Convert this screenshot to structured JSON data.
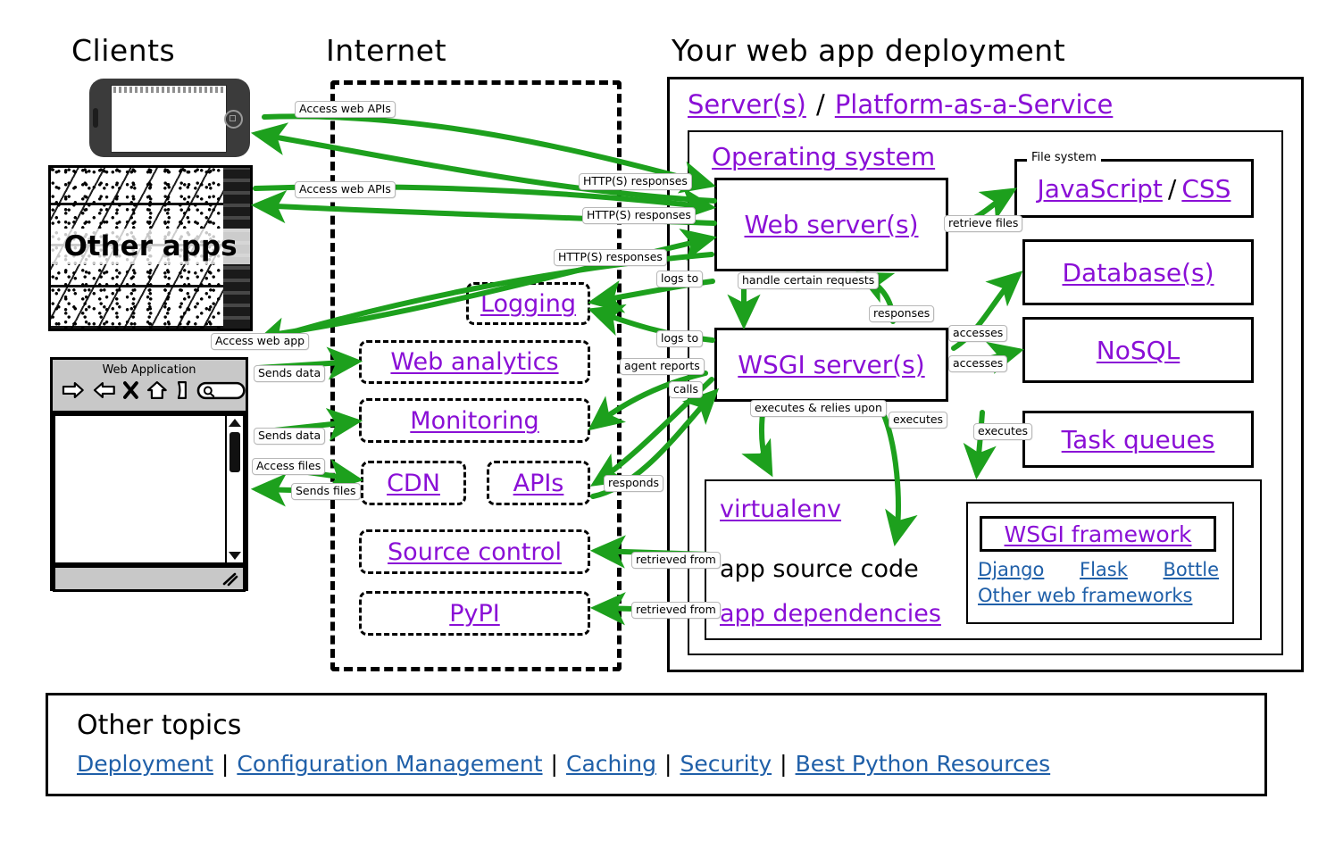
{
  "columns": {
    "clients": "Clients",
    "internet": "Internet",
    "deployment": "Your web app deployment"
  },
  "clients": {
    "phone": {
      "name": "smartphone-client"
    },
    "other_apps": {
      "caption": "Other apps"
    },
    "browser": {
      "title": "Web Application",
      "icons": [
        "back-arrow-icon",
        "forward-arrow-icon",
        "stop-x-icon",
        "home-icon",
        "page-icon",
        "search-box-icon"
      ]
    }
  },
  "internet": {
    "boxes": [
      {
        "label": "Logging"
      },
      {
        "label": "Web analytics"
      },
      {
        "label": "Monitoring"
      },
      {
        "label": "CDN"
      },
      {
        "label": "APIs"
      },
      {
        "label": "Source control"
      },
      {
        "label": "PyPI"
      }
    ]
  },
  "deployment": {
    "outer_label": {
      "part1": "Server(s)",
      "slash": "/",
      "part2": "Platform-as-a-Service"
    },
    "os_label": "Operating system",
    "web_server": "Web server(s)",
    "wsgi_server": "WSGI server(s)",
    "file_system_legend": "File system",
    "file_system": {
      "part1": "JavaScript",
      "slash": "/",
      "part2": "CSS"
    },
    "database": "Database(s)",
    "nosql": "NoSQL",
    "task_queues": "Task queues",
    "virtualenv": {
      "title": "virtualenv",
      "source_code": "app source code",
      "dependencies": "app dependencies"
    },
    "wsgi_framework": {
      "title": "WSGI framework",
      "frameworks": [
        "Django",
        "Flask",
        "Bottle"
      ],
      "other": "Other web frameworks"
    }
  },
  "edge_labels": {
    "access_web_apis_1": "Access web APIs",
    "access_web_apis_2": "Access web APIs",
    "http_responses_1": "HTTP(S) responses",
    "http_responses_2": "HTTP(S) responses",
    "http_responses_3": "HTTP(S) responses",
    "access_web_app": "Access web app",
    "sends_data_1": "Sends data",
    "sends_data_2": "Sends data",
    "access_files": "Access files",
    "sends_files": "Sends files",
    "logs_to_1": "logs to",
    "logs_to_2": "logs to",
    "agent_reports": "agent reports",
    "calls": "calls",
    "responds": "responds",
    "retrieve_files": "retrieve files",
    "handle_certain_requests": "handle certain requests",
    "responses": "responses",
    "accesses_1": "accesses",
    "accesses_2": "accesses",
    "executes_1": "executes",
    "executes_2": "executes",
    "executes_relies_upon": "executes & relies upon",
    "retrieved_from_1": "retrieved from",
    "retrieved_from_2": "retrieved from"
  },
  "other_topics": {
    "title": "Other topics",
    "links": [
      "Deployment",
      "Configuration Management",
      "Caching",
      "Security",
      "Best Python Resources"
    ],
    "separator": "|"
  },
  "colors": {
    "link_purple": "#8A0FD6",
    "link_blue": "#1F5FA8",
    "arrow_green": "#1DA01D",
    "border_black": "#000000",
    "chrome_gray": "#C8C8C8"
  }
}
